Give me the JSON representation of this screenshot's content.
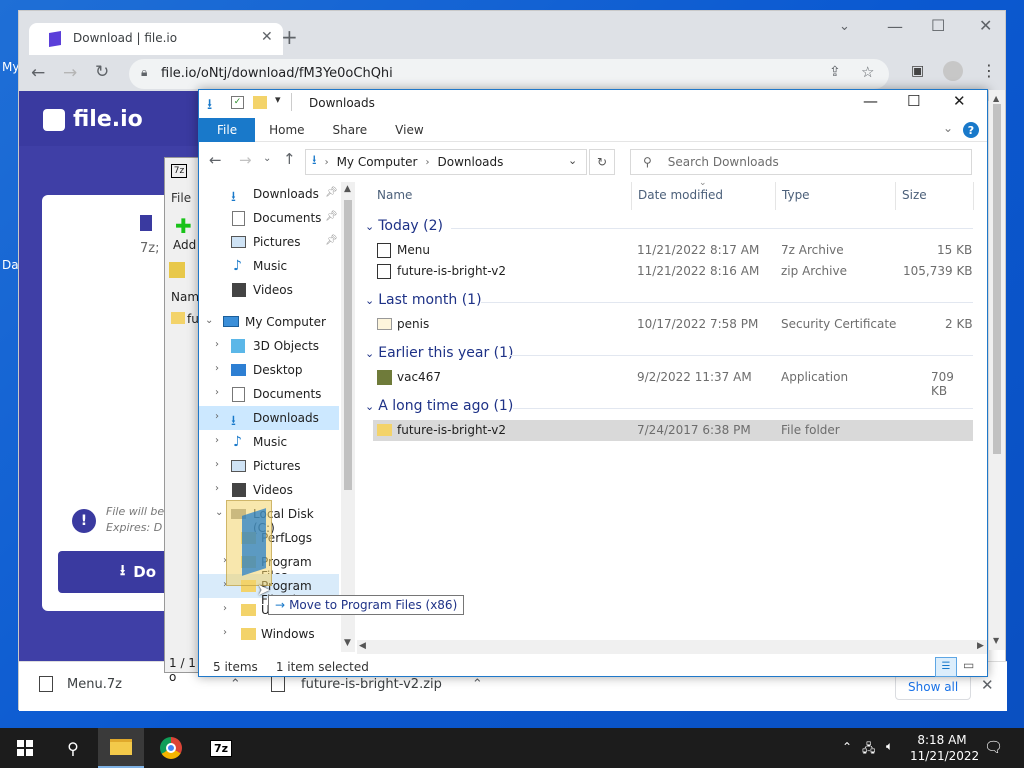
{
  "desktop": {
    "label_1": "My",
    "label_2": "Da"
  },
  "browser": {
    "tab_title": "Download | file.io",
    "url": "file.io/oNtj/download/fM3Ye0oChQhi",
    "page": {
      "logo": "file.io",
      "partial_ext": "7z;",
      "warn_line1": "File will be",
      "warn_line2": "Expires: D",
      "download_btn": "Do"
    },
    "downloads": [
      {
        "name": "Menu.7z"
      },
      {
        "name": "future-is-bright-v2.zip"
      }
    ],
    "show_all": "Show all"
  },
  "sevenzip": {
    "menu": "File",
    "add": "Add",
    "col": "Nam",
    "item": "fut",
    "status": "1 / 1 o"
  },
  "explorer": {
    "title": "Downloads",
    "ribbon_tabs": [
      "File",
      "Home",
      "Share",
      "View"
    ],
    "breadcrumb": [
      "My Computer",
      "Downloads"
    ],
    "search_placeholder": "Search Downloads",
    "nav": [
      {
        "label": "Downloads",
        "pinned": true
      },
      {
        "label": "Documents",
        "pinned": true
      },
      {
        "label": "Pictures",
        "pinned": true
      },
      {
        "label": "Music"
      },
      {
        "label": "Videos"
      },
      {
        "label": "My Computer"
      },
      {
        "label": "3D Objects"
      },
      {
        "label": "Desktop"
      },
      {
        "label": "Documents"
      },
      {
        "label": "Downloads"
      },
      {
        "label": "Music"
      },
      {
        "label": "Pictures"
      },
      {
        "label": "Videos"
      },
      {
        "label": "Local Disk (C:)"
      },
      {
        "label": "PerfLogs"
      },
      {
        "label": "Program Files"
      },
      {
        "label": "Program Files ("
      },
      {
        "label": "U"
      },
      {
        "label": "Windows"
      }
    ],
    "columns": {
      "name": "Name",
      "date": "Date modified",
      "type": "Type",
      "size": "Size"
    },
    "groups": [
      {
        "title": "Today (2)",
        "files": [
          {
            "name": "Menu",
            "date": "11/21/2022 8:17 AM",
            "type": "7z Archive",
            "size": "15 KB"
          },
          {
            "name": "future-is-bright-v2",
            "date": "11/21/2022 8:16 AM",
            "type": "zip Archive",
            "size": "105,739 KB"
          }
        ]
      },
      {
        "title": "Last month (1)",
        "files": [
          {
            "name": "penis",
            "date": "10/17/2022 7:58 PM",
            "type": "Security Certificate",
            "size": "2 KB"
          }
        ]
      },
      {
        "title": "Earlier this year (1)",
        "files": [
          {
            "name": "vac467",
            "date": "9/2/2022 11:37 AM",
            "type": "Application",
            "size": "709 KB"
          }
        ]
      },
      {
        "title": "A long time ago (1)",
        "files": [
          {
            "name": "future-is-bright-v2",
            "date": "7/24/2017 6:38 PM",
            "type": "File folder",
            "size": ""
          }
        ]
      }
    ],
    "status_items": "5 items",
    "status_selected": "1 item selected",
    "drag_tooltip": "Move to Program Files (x86)"
  },
  "taskbar": {
    "time": "8:18 AM",
    "date": "11/21/2022",
    "app_7z": "7z"
  },
  "colors": {
    "accent": "#1979ca",
    "fileio": "#3a3aa0",
    "selection": "#cce8ff",
    "group_text": "#1e3287"
  }
}
